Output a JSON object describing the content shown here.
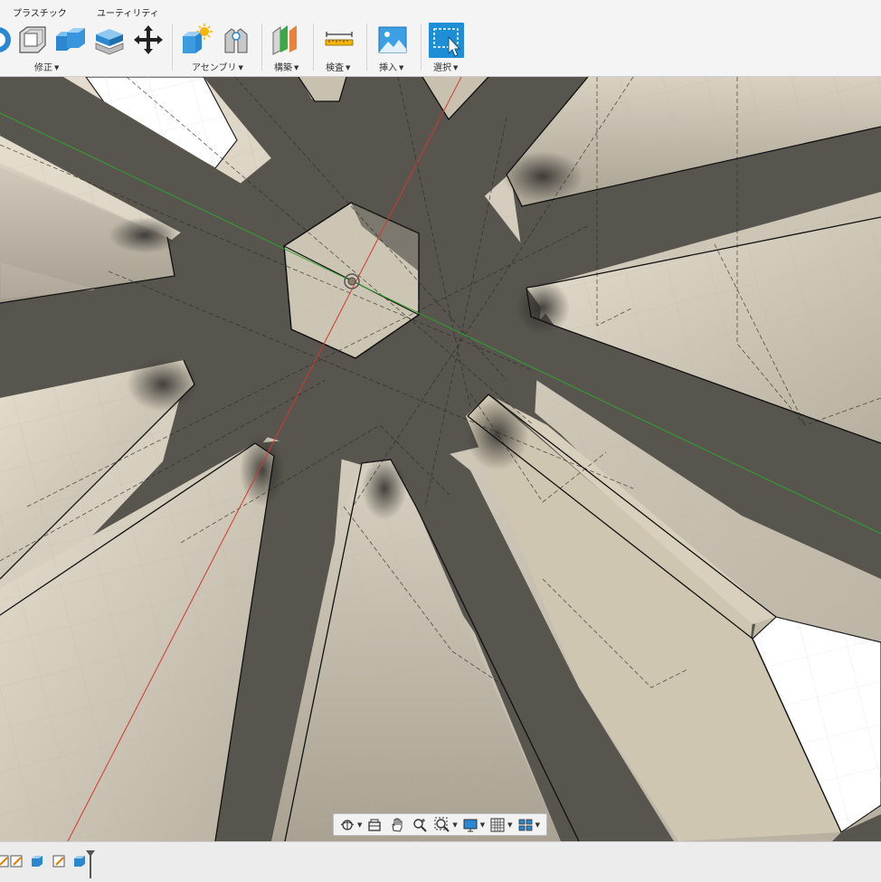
{
  "toolbar": {
    "tabs": [
      {
        "label": "プラスチック"
      },
      {
        "label": "ユーティリティ"
      }
    ],
    "groups": [
      {
        "label": "修正",
        "tools": [
          "press-pull-icon",
          "shell-icon",
          "combine-icon",
          "offset-face-icon",
          "move-icon"
        ]
      },
      {
        "label": "アセンブリ",
        "tools": [
          "new-component-icon",
          "joint-icon"
        ]
      },
      {
        "label": "構築",
        "tools": [
          "offset-plane-icon"
        ]
      },
      {
        "label": "検査",
        "tools": [
          "measure-icon"
        ]
      },
      {
        "label": "挿入",
        "tools": [
          "insert-image-icon"
        ]
      },
      {
        "label": "選択",
        "tools": [
          "select-icon"
        ]
      }
    ]
  },
  "colors": {
    "body_gray": "#58554f",
    "face_beige": "#cfc7b6",
    "x_axis": "#d4382b",
    "y_axis": "#2ea32e",
    "select_accent": "#1e8fd6"
  },
  "navbar": {
    "tools": [
      "orbit-icon",
      "look-at-icon",
      "pan-icon",
      "zoom-icon",
      "fit-icon",
      "display-settings-icon",
      "grid-settings-icon",
      "viewports-icon"
    ]
  },
  "timeline": {
    "items": [
      "sketch-icon",
      "body-icon",
      "sketch-icon",
      "body-icon"
    ]
  }
}
